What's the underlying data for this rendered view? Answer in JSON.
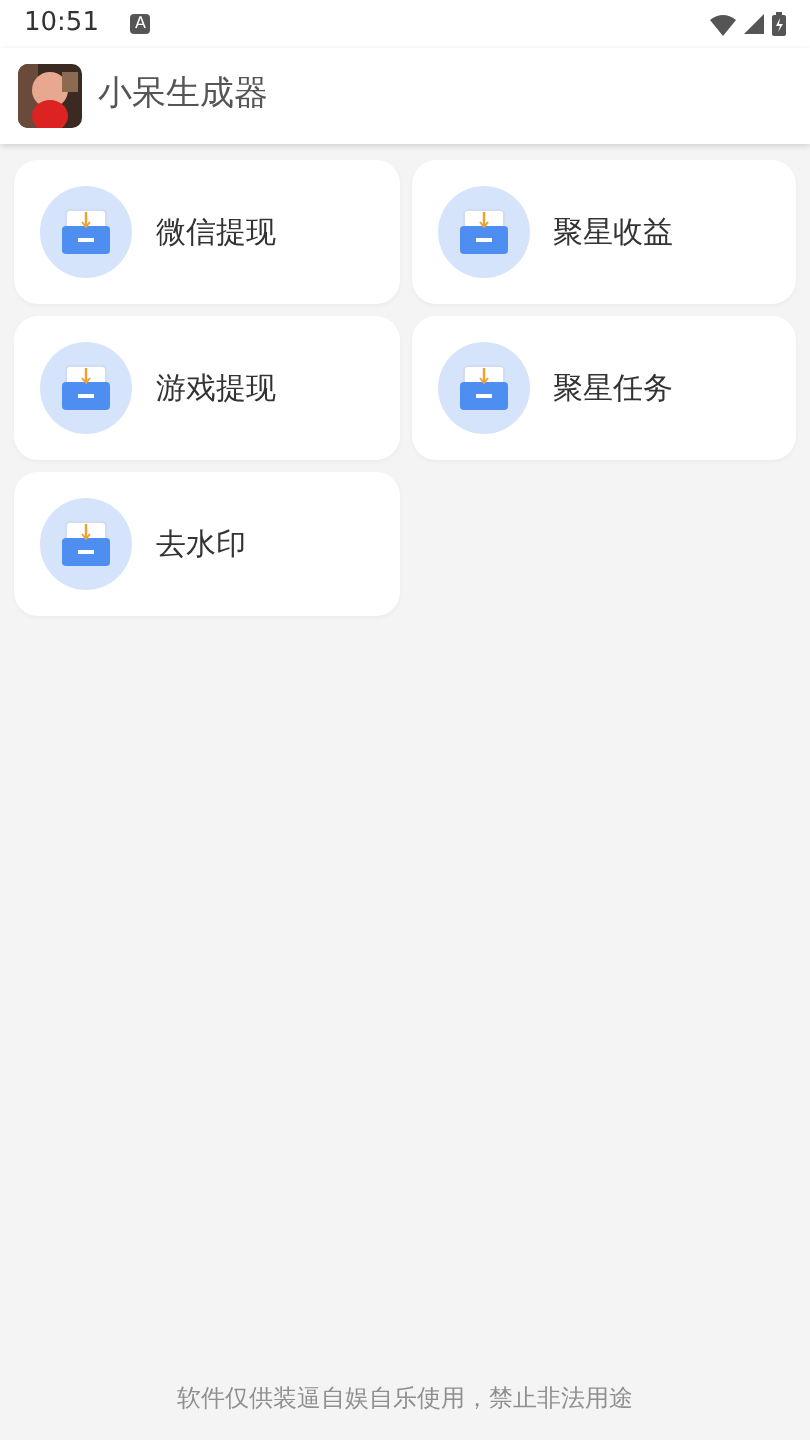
{
  "status_bar": {
    "time": "10:51",
    "notification": "A"
  },
  "app_bar": {
    "title": "小呆生成器"
  },
  "tiles": [
    {
      "label": "微信提现"
    },
    {
      "label": "聚星收益"
    },
    {
      "label": "游戏提现"
    },
    {
      "label": "聚星任务"
    },
    {
      "label": "去水印"
    }
  ],
  "footer": "软件仅供装逼自娱自乐使用，禁止非法用途"
}
